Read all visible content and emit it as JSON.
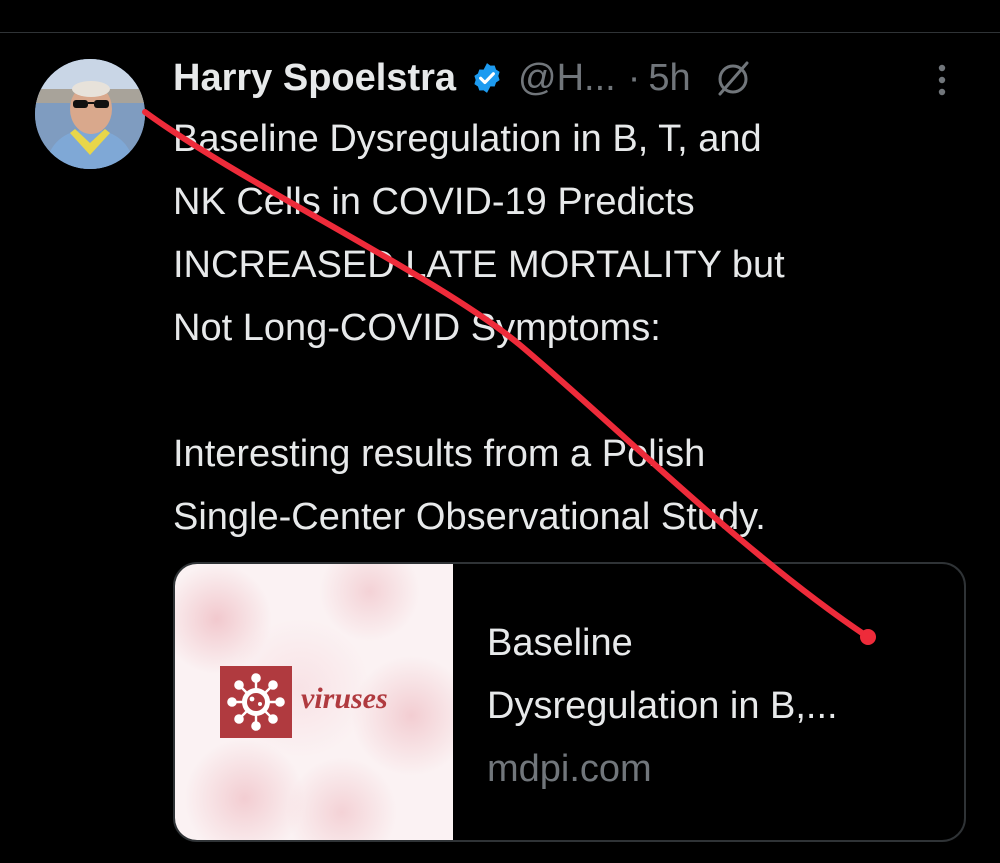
{
  "tweet": {
    "author": {
      "display_name": "Harry Spoelstra",
      "handle": "@H...",
      "verified": true,
      "verified_color": "#1d9bf0"
    },
    "separator": "·",
    "time": "5h",
    "body": {
      "paragraph1": [
        "Baseline Dysregulation in B, T, and",
        "NK Cells in COVID-19 Predicts",
        "INCREASED LATE MORTALITY but",
        "Not Long-COVID Symptoms:"
      ],
      "paragraph2": [
        "Interesting results from a Polish",
        "Single-Center Observational Study."
      ]
    },
    "link_card": {
      "logo_text": "viruses",
      "title_lines": [
        "Baseline",
        "Dysregulation in B,..."
      ],
      "domain": "mdpi.com"
    }
  },
  "icons": {
    "verified": "verified-badge-icon",
    "grok": "grok-icon",
    "more": "more-icon",
    "virus_logo": "virus-logo-icon"
  },
  "colors": {
    "background": "#000000",
    "text_primary": "#e7e9ea",
    "text_secondary": "#71767b",
    "border": "#2f3336",
    "annotation_stroke": "#ee2b3a",
    "logo": "#b03a3f"
  }
}
